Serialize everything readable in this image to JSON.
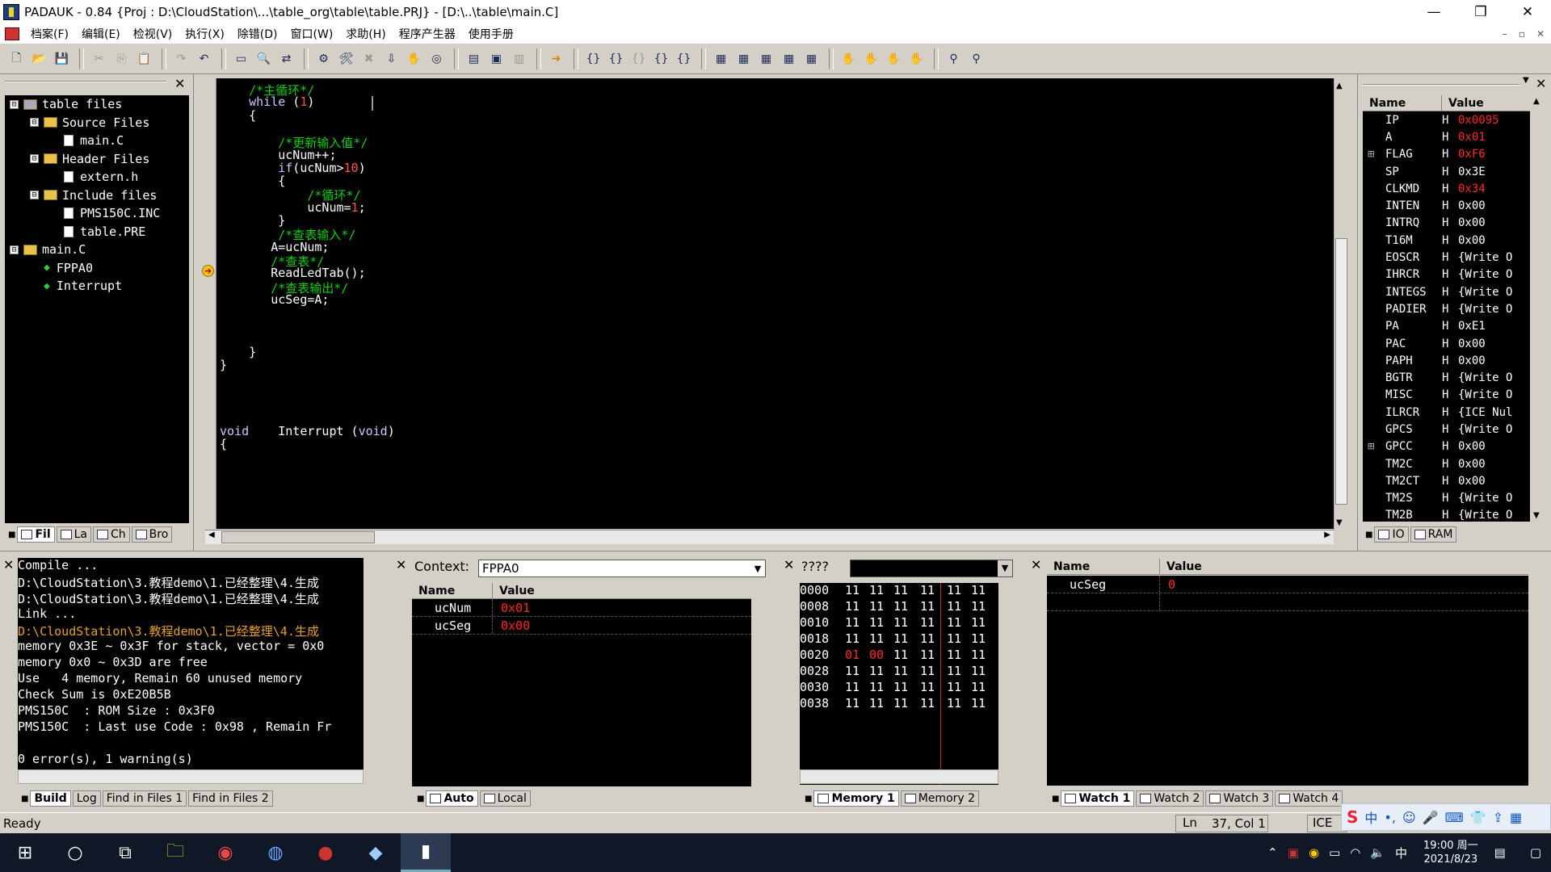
{
  "window": {
    "title": "PADAUK - 0.84 {Proj : D:\\CloudStation\\...\\table_org\\table\\table.PRJ} - [D:\\..\\table\\main.C]",
    "minimize": "—",
    "restore": "❐",
    "close": "✕"
  },
  "menu": [
    "档案(F)",
    "编辑(E)",
    "检视(V)",
    "执行(X)",
    "除错(D)",
    "窗口(W)",
    "求助(H)",
    "程序产生器",
    "使用手册"
  ],
  "menu_right": [
    "–",
    "▫",
    "✕"
  ],
  "tree": [
    {
      "label": "table files",
      "level": 0,
      "kind": "root",
      "exp": "⊟"
    },
    {
      "label": "Source Files",
      "level": 1,
      "kind": "folder",
      "exp": "⊟"
    },
    {
      "label": "main.C",
      "level": 2,
      "kind": "file"
    },
    {
      "label": "Header Files",
      "level": 1,
      "kind": "folder",
      "exp": "⊟"
    },
    {
      "label": "extern.h",
      "level": 2,
      "kind": "file"
    },
    {
      "label": "Include files",
      "level": 1,
      "kind": "folder",
      "exp": "⊟"
    },
    {
      "label": "PMS150C.INC",
      "level": 2,
      "kind": "file"
    },
    {
      "label": "table.PRE",
      "level": 2,
      "kind": "file"
    },
    {
      "label": "main.C",
      "level": 0,
      "kind": "folder",
      "exp": "⊟"
    },
    {
      "label": "FPPA0",
      "level": 1,
      "kind": "fn"
    },
    {
      "label": "Interrupt",
      "level": 1,
      "kind": "fn"
    }
  ],
  "tree_tabs": [
    "Fil",
    "La",
    "Ch",
    "Bro"
  ],
  "code": [
    {
      "line": 0,
      "indent": 4,
      "parts": [
        {
          "t": "/*主循环*/",
          "c": "cm"
        }
      ]
    },
    {
      "line": 1,
      "indent": 4,
      "parts": [
        {
          "t": "while",
          "c": "kw"
        },
        {
          "t": " (",
          "c": ""
        },
        {
          "t": "1",
          "c": "num"
        },
        {
          "t": ")",
          "c": ""
        }
      ]
    },
    {
      "line": 2,
      "indent": 4,
      "parts": [
        {
          "t": "{",
          "c": ""
        }
      ]
    },
    {
      "line": 4,
      "indent": 8,
      "parts": [
        {
          "t": "/*更新输入值*/",
          "c": "cm"
        }
      ]
    },
    {
      "line": 5,
      "indent": 8,
      "parts": [
        {
          "t": "ucNum++;",
          "c": ""
        }
      ]
    },
    {
      "line": 6,
      "indent": 8,
      "parts": [
        {
          "t": "if",
          "c": "kw"
        },
        {
          "t": "(ucNum>",
          "c": ""
        },
        {
          "t": "10",
          "c": "num"
        },
        {
          "t": ")",
          "c": ""
        }
      ]
    },
    {
      "line": 7,
      "indent": 8,
      "parts": [
        {
          "t": "{",
          "c": ""
        }
      ]
    },
    {
      "line": 8,
      "indent": 12,
      "parts": [
        {
          "t": "/*循环*/",
          "c": "cm"
        }
      ]
    },
    {
      "line": 9,
      "indent": 12,
      "parts": [
        {
          "t": "ucNum=",
          "c": ""
        },
        {
          "t": "1",
          "c": "num"
        },
        {
          "t": ";",
          "c": ""
        }
      ]
    },
    {
      "line": 10,
      "indent": 8,
      "parts": [
        {
          "t": "}",
          "c": ""
        }
      ]
    },
    {
      "line": 11,
      "indent": 8,
      "parts": [
        {
          "t": "/*查表输入*/",
          "c": "cm"
        }
      ]
    },
    {
      "line": 12,
      "indent": 7,
      "parts": [
        {
          "t": "A=ucNum;",
          "c": ""
        }
      ]
    },
    {
      "line": 13,
      "indent": 7,
      "parts": [
        {
          "t": "/*查表*/",
          "c": "cm"
        }
      ]
    },
    {
      "line": 14,
      "indent": 7,
      "parts": [
        {
          "t": "ReadLedTab();",
          "c": ""
        }
      ]
    },
    {
      "line": 15,
      "indent": 7,
      "parts": [
        {
          "t": "/*查表输出*/",
          "c": "cm"
        }
      ]
    },
    {
      "line": 16,
      "indent": 7,
      "parts": [
        {
          "t": "ucSeg=A;",
          "c": ""
        }
      ]
    },
    {
      "line": 20,
      "indent": 4,
      "parts": [
        {
          "t": "}",
          "c": ""
        }
      ]
    },
    {
      "line": 21,
      "indent": 0,
      "parts": [
        {
          "t": "}",
          "c": ""
        }
      ]
    },
    {
      "line": 26,
      "indent": 0,
      "parts": [
        {
          "t": "void",
          "c": "kw"
        },
        {
          "t": "    Interrupt (",
          "c": ""
        },
        {
          "t": "void",
          "c": "kw"
        },
        {
          "t": ")",
          "c": ""
        }
      ]
    },
    {
      "line": 27,
      "indent": 0,
      "parts": [
        {
          "t": "{",
          "c": ""
        }
      ]
    }
  ],
  "breakpoint_line": 14,
  "registers": {
    "headers": {
      "name": "Name",
      "value": "Value"
    },
    "rows": [
      {
        "name": "IP",
        "h": "H",
        "value": "0x0095",
        "red": true
      },
      {
        "name": "A",
        "h": "H",
        "value": "0x01",
        "red": true
      },
      {
        "name": "FLAG",
        "h": "H",
        "value": "0xF6",
        "red": true,
        "exp": true
      },
      {
        "name": "SP",
        "h": "H",
        "value": "0x3E"
      },
      {
        "name": "CLKMD",
        "h": "H",
        "value": "0x34",
        "red": true
      },
      {
        "name": "INTEN",
        "h": "H",
        "value": "0x00"
      },
      {
        "name": "INTRQ",
        "h": "H",
        "value": "0x00"
      },
      {
        "name": "T16M",
        "h": "H",
        "value": "0x00"
      },
      {
        "name": "EOSCR",
        "h": "H",
        "value": "{Write O"
      },
      {
        "name": "IHRCR",
        "h": "H",
        "value": "{Write O"
      },
      {
        "name": "INTEGS",
        "h": "H",
        "value": "{Write O"
      },
      {
        "name": "PADIER",
        "h": "H",
        "value": "{Write O"
      },
      {
        "name": "PA",
        "h": "H",
        "value": "0xE1"
      },
      {
        "name": "PAC",
        "h": "H",
        "value": "0x00"
      },
      {
        "name": "PAPH",
        "h": "H",
        "value": "0x00"
      },
      {
        "name": "BGTR",
        "h": "H",
        "value": "{Write O"
      },
      {
        "name": "MISC",
        "h": "H",
        "value": "{Write O"
      },
      {
        "name": "ILRCR",
        "h": "H",
        "value": "{ICE Nul"
      },
      {
        "name": "GPCS",
        "h": "H",
        "value": "{Write O"
      },
      {
        "name": "GPCC",
        "h": "H",
        "value": "0x00",
        "exp": true
      },
      {
        "name": "TM2C",
        "h": "H",
        "value": "0x00"
      },
      {
        "name": "TM2CT",
        "h": "H",
        "value": "0x00"
      },
      {
        "name": "TM2S",
        "h": "H",
        "value": "{Write O"
      },
      {
        "name": "TM2B",
        "h": "H",
        "value": "{Write O"
      }
    ],
    "tabs": [
      "IO",
      "RAM"
    ]
  },
  "build": {
    "lines": [
      {
        "t": "Compile ...",
        "c": "#fff"
      },
      {
        "t": "D:\\CloudStation\\3.教程demo\\1.已经整理\\4.生成",
        "c": "#fff"
      },
      {
        "t": "D:\\CloudStation\\3.教程demo\\1.已经整理\\4.生成",
        "c": "#fff"
      },
      {
        "t": "Link ...",
        "c": "#fff"
      },
      {
        "t": "D:\\CloudStation\\3.教程demo\\1.已经整理\\4.生成",
        "c": "#e8a020"
      },
      {
        "t": "memory 0x3E ~ 0x3F for stack, vector = 0x0",
        "c": "#fff"
      },
      {
        "t": "memory 0x0 ~ 0x3D are free",
        "c": "#fff"
      },
      {
        "t": "Use   4 memory, Remain 60 unused memory",
        "c": "#fff"
      },
      {
        "t": "Check Sum is 0xE20B5B",
        "c": "#fff"
      },
      {
        "t": "PMS150C  : ROM Size : 0x3F0",
        "c": "#fff"
      },
      {
        "t": "PMS150C  : Last use Code : 0x98 , Remain Fr",
        "c": "#fff"
      },
      {
        "t": "",
        "c": "#fff"
      },
      {
        "t": "0 error(s), 1 warning(s)",
        "c": "#fff"
      }
    ],
    "tabs": [
      "Build",
      "Log",
      "Find in Files 1",
      "Find in Files 2"
    ]
  },
  "context": {
    "label": "Context:",
    "value": "FPPA0",
    "headers": {
      "name": "Name",
      "value": "Value"
    },
    "rows": [
      {
        "name": "ucNum",
        "value": "0x01"
      },
      {
        "name": "ucSeg",
        "value": "0x00"
      }
    ],
    "tabs": [
      "Auto",
      "Local"
    ]
  },
  "memory": {
    "label": "????",
    "rows": [
      {
        "addr": "0000",
        "cells": [
          "11",
          "11",
          "11",
          "11",
          "11",
          "11"
        ]
      },
      {
        "addr": "0008",
        "cells": [
          "11",
          "11",
          "11",
          "11",
          "11",
          "11"
        ]
      },
      {
        "addr": "0010",
        "cells": [
          "11",
          "11",
          "11",
          "11",
          "11",
          "11"
        ]
      },
      {
        "addr": "0018",
        "cells": [
          "11",
          "11",
          "11",
          "11",
          "11",
          "11"
        ]
      },
      {
        "addr": "0020",
        "cells": [
          "01",
          "00",
          "11",
          "11",
          "11",
          "11"
        ],
        "red": [
          0,
          1
        ],
        "addr_red": true
      },
      {
        "addr": "0028",
        "cells": [
          "11",
          "11",
          "11",
          "11",
          "11",
          "11"
        ]
      },
      {
        "addr": "0030",
        "cells": [
          "11",
          "11",
          "11",
          "11",
          "11",
          "11"
        ]
      },
      {
        "addr": "0038",
        "cells": [
          "11",
          "11",
          "11",
          "11",
          "11",
          "11"
        ]
      }
    ],
    "tabs": [
      "Memory 1",
      "Memory 2"
    ]
  },
  "watch": {
    "headers": {
      "name": "Name",
      "value": "Value"
    },
    "rows": [
      {
        "name": "ucSeg",
        "value": "0"
      }
    ],
    "tabs": [
      "Watch 1",
      "Watch 2",
      "Watch 3",
      "Watch 4"
    ]
  },
  "status": {
    "ready": "Ready",
    "ln": "Ln",
    "pos": "37, Col 1",
    "mode": "ICE"
  },
  "taskbar": {
    "time": "19:00 周一",
    "date": "2021/8/23",
    "ime": "中"
  }
}
